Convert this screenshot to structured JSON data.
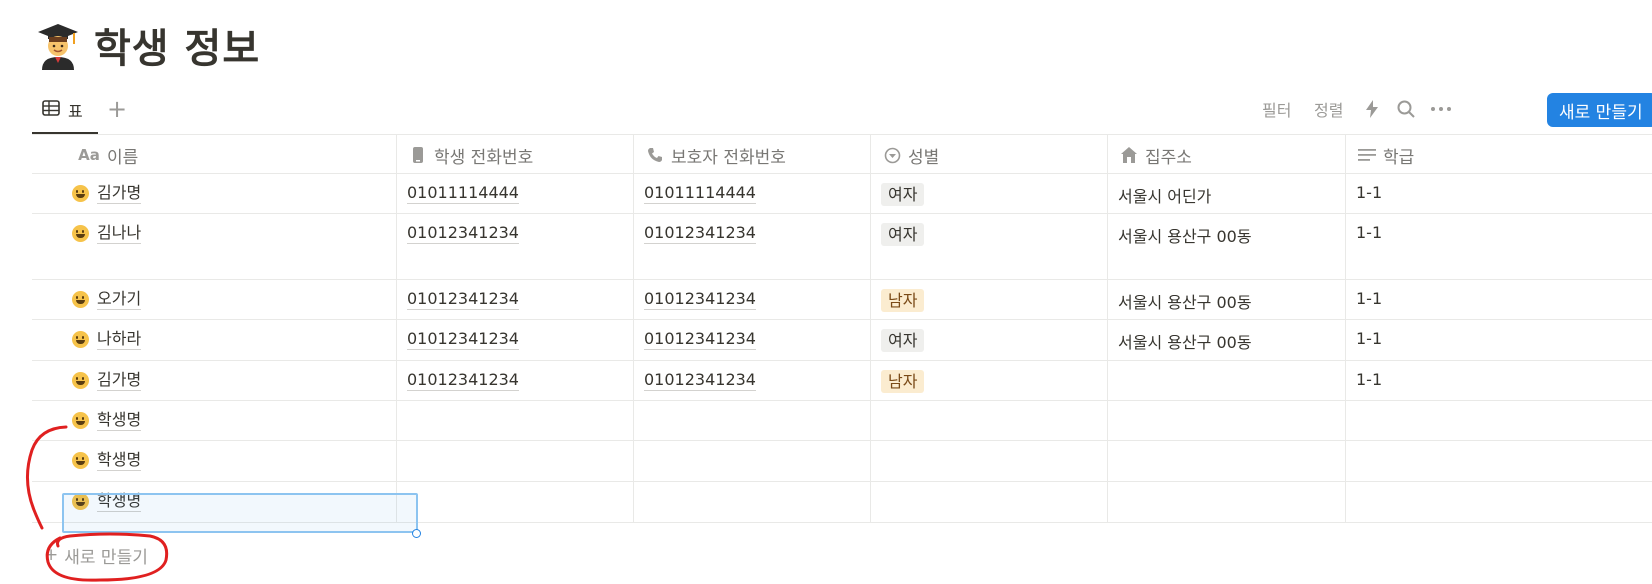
{
  "page": {
    "title": "학생 정보",
    "emoji_icon": "student-emoji-icon"
  },
  "views": {
    "active_tab": "표",
    "add_view_label": "+"
  },
  "toolbar": {
    "filter": "필터",
    "sort": "정렬",
    "new_button": "새로 만들기"
  },
  "columns": [
    {
      "label": "이름",
      "icon": "Aa"
    },
    {
      "label": "학생 전화번호",
      "icon": "phone-icon"
    },
    {
      "label": "보호자 전화번호",
      "icon": "call-icon"
    },
    {
      "label": "성별",
      "icon": "select-icon"
    },
    {
      "label": "집주소",
      "icon": "house-icon"
    },
    {
      "label": "학급",
      "icon": "text-icon"
    }
  ],
  "rows": [
    {
      "name": "김가명",
      "student_phone": "01011114444",
      "guardian_phone": "01011114444",
      "gender": "여자",
      "address": "서울시 어딘가",
      "class": "1-1"
    },
    {
      "name": "김나나",
      "student_phone": "01012341234",
      "guardian_phone": "01012341234",
      "gender": "여자",
      "address": "서울시 용산구 00동",
      "class": "1-1"
    },
    {
      "name": "오가기",
      "student_phone": "01012341234",
      "guardian_phone": "01012341234",
      "gender": "남자",
      "address": "서울시 용산구 00동",
      "class": "1-1"
    },
    {
      "name": "나하라",
      "student_phone": "01012341234",
      "guardian_phone": "01012341234",
      "gender": "여자",
      "address": "서울시 용산구 00동",
      "class": "1-1"
    },
    {
      "name": "김가명",
      "student_phone": "01012341234",
      "guardian_phone": "01012341234",
      "gender": "남자",
      "address": "",
      "class": "1-1"
    },
    {
      "name": "학생명",
      "student_phone": "",
      "guardian_phone": "",
      "gender": "",
      "address": "",
      "class": ""
    },
    {
      "name": "학생명",
      "student_phone": "",
      "guardian_phone": "",
      "gender": "",
      "address": "",
      "class": ""
    },
    {
      "name": "학생명",
      "student_phone": "",
      "guardian_phone": "",
      "gender": "",
      "address": "",
      "class": ""
    }
  ],
  "add_row_label": "새로 만들기",
  "colors": {
    "accent": "#2383e2",
    "annotation": "#e02020",
    "tag_female": "#efefed",
    "tag_male": "#fbecd0"
  }
}
